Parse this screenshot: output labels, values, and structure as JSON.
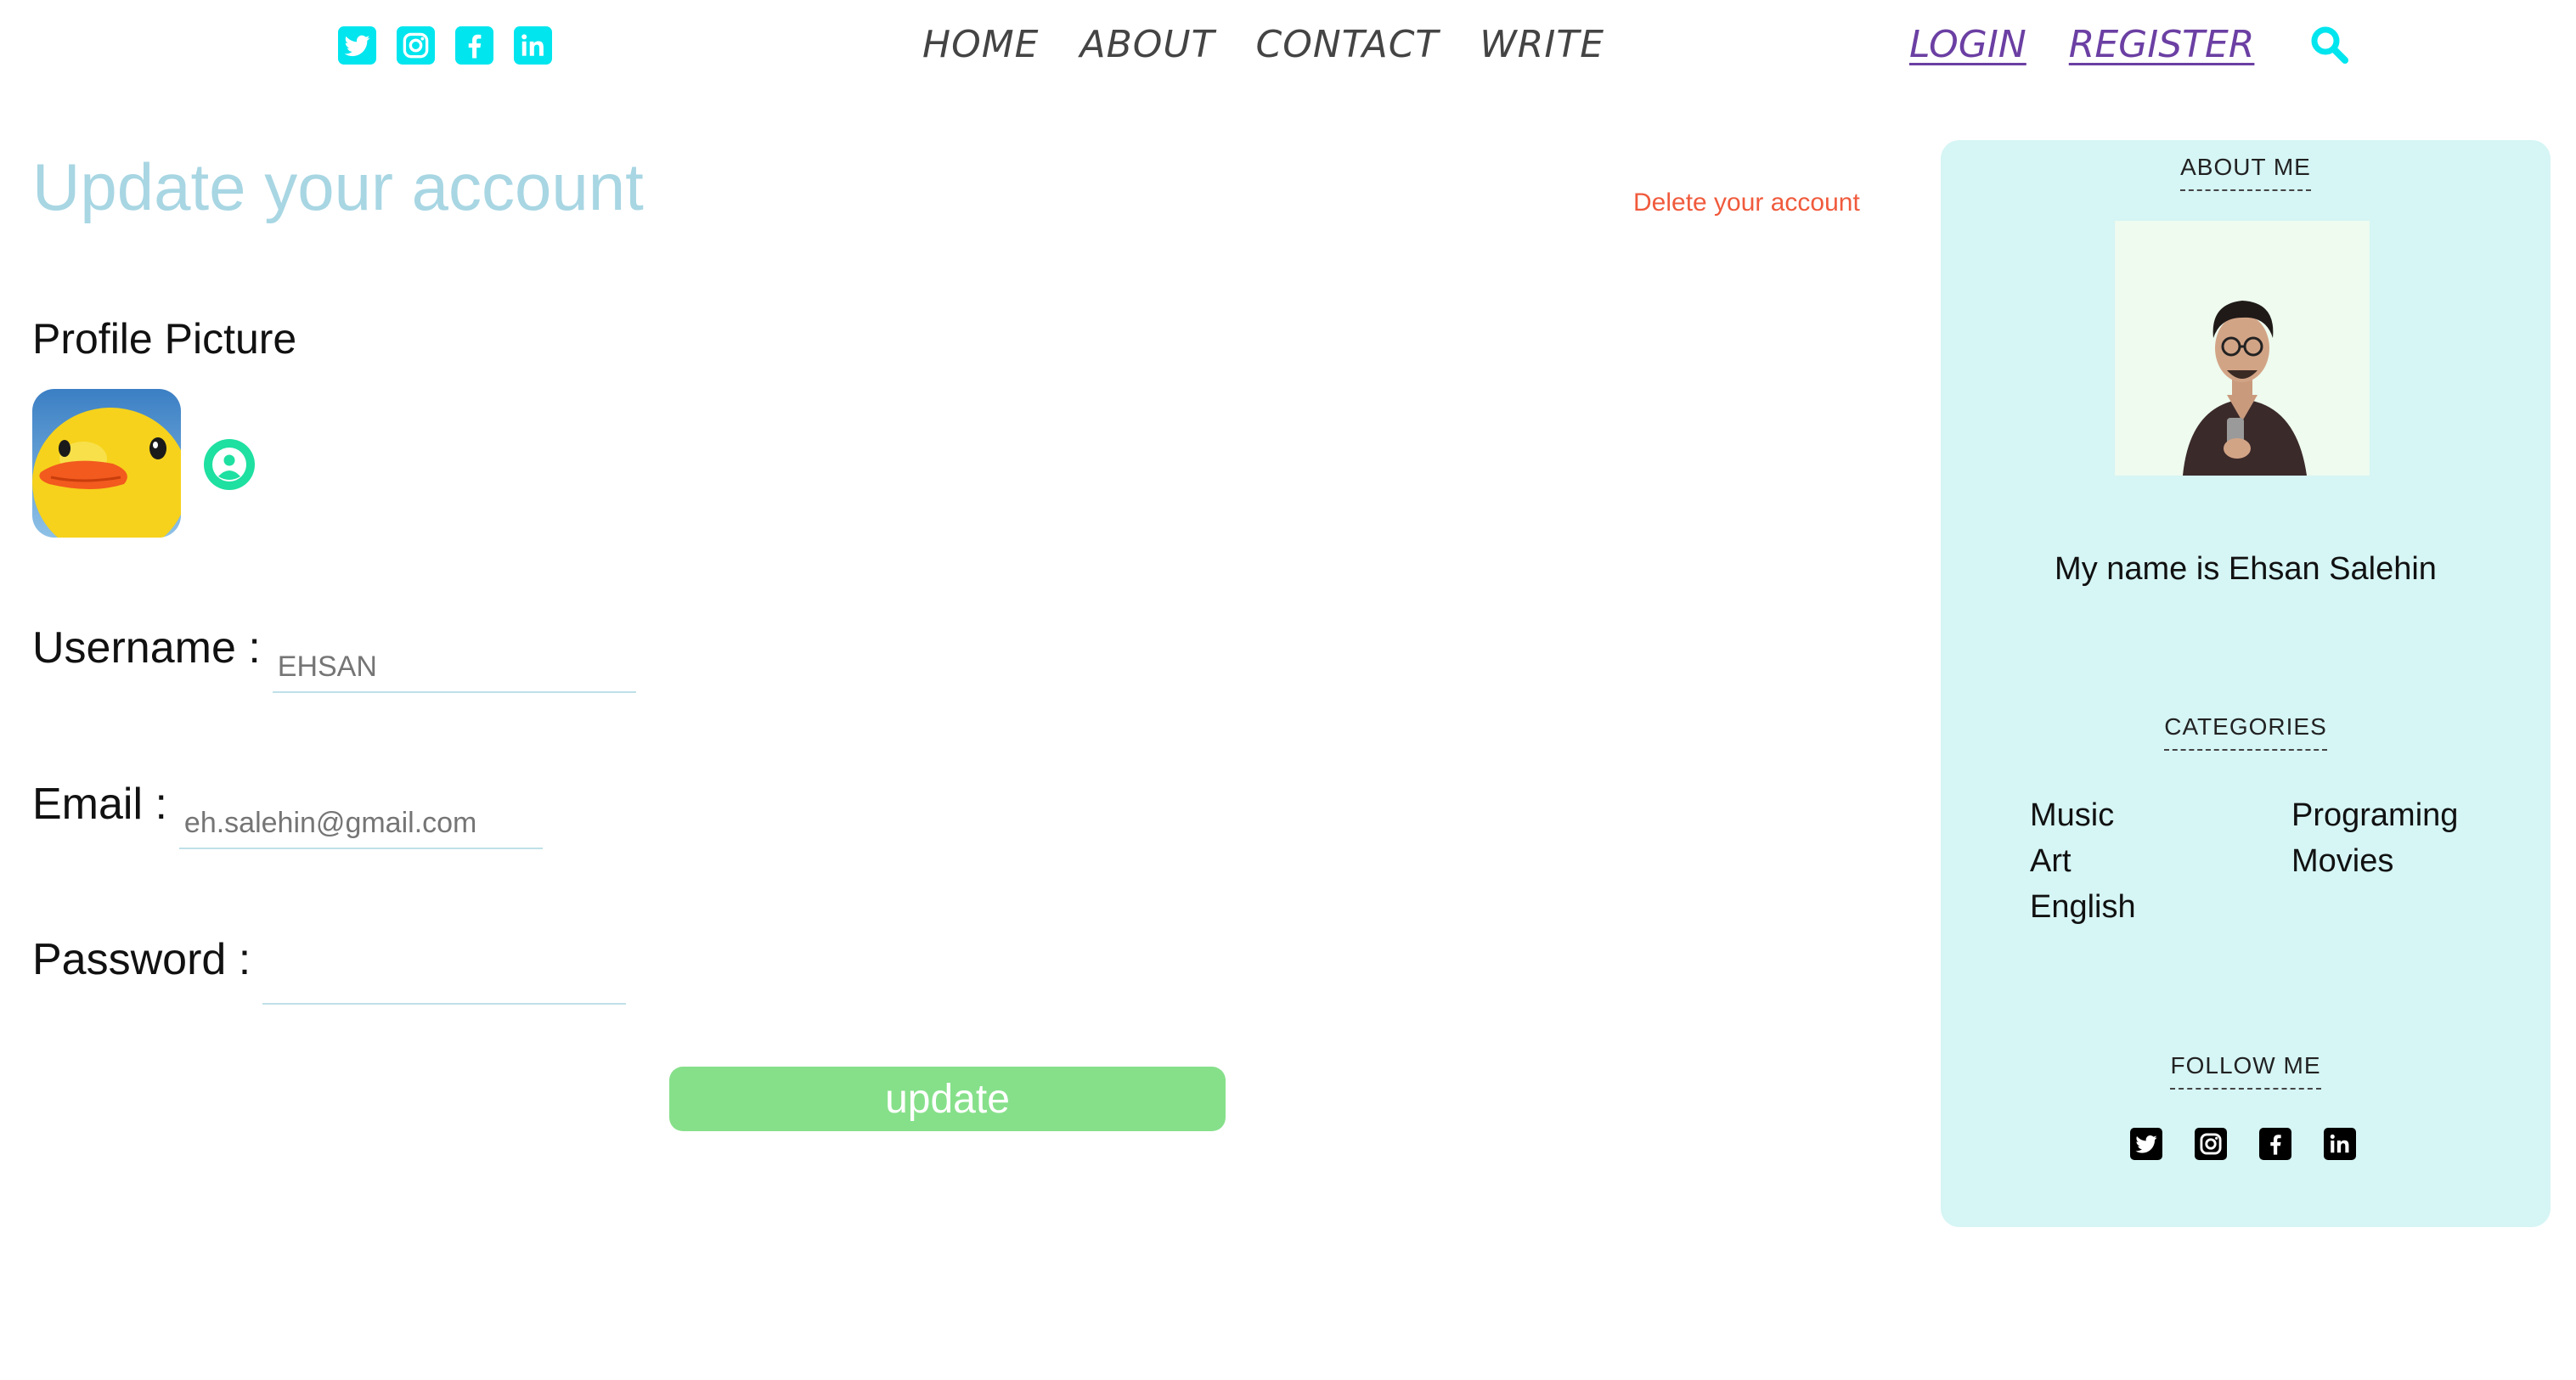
{
  "colors": {
    "accent": "#00e5ee",
    "title": "#a8d6e3",
    "danger": "#f05a3c",
    "button": "#86e08a",
    "sidebar_bg": "#d6f5f5",
    "link": "#6b3fa3"
  },
  "header": {
    "social": [
      "twitter-icon",
      "instagram-icon",
      "facebook-icon",
      "linkedin-icon"
    ],
    "nav": [
      "HOME",
      "ABOUT",
      "CONTACT",
      "WRITE"
    ],
    "auth": {
      "login": "LOGIN",
      "register": "REGISTER"
    },
    "search_icon": "search-icon"
  },
  "main": {
    "title": "Update your account",
    "delete_label": "Delete your account",
    "profile_label": "Profile Picture",
    "username_label": "Username :",
    "username_placeholder": "EHSAN",
    "email_label": "Email :",
    "email_placeholder": "eh.salehin@gmail.com",
    "password_label": "Password :",
    "update_label": "update"
  },
  "sidebar": {
    "about_title": "ABOUT ME",
    "description": "My name is Ehsan Salehin",
    "categories_title": "CATEGORIES",
    "categories": [
      "Music",
      "Programing",
      "Art",
      "Movies",
      "English"
    ],
    "follow_title": "FOLLOW ME",
    "social": [
      "twitter-icon",
      "instagram-icon",
      "facebook-icon",
      "linkedin-icon"
    ]
  }
}
